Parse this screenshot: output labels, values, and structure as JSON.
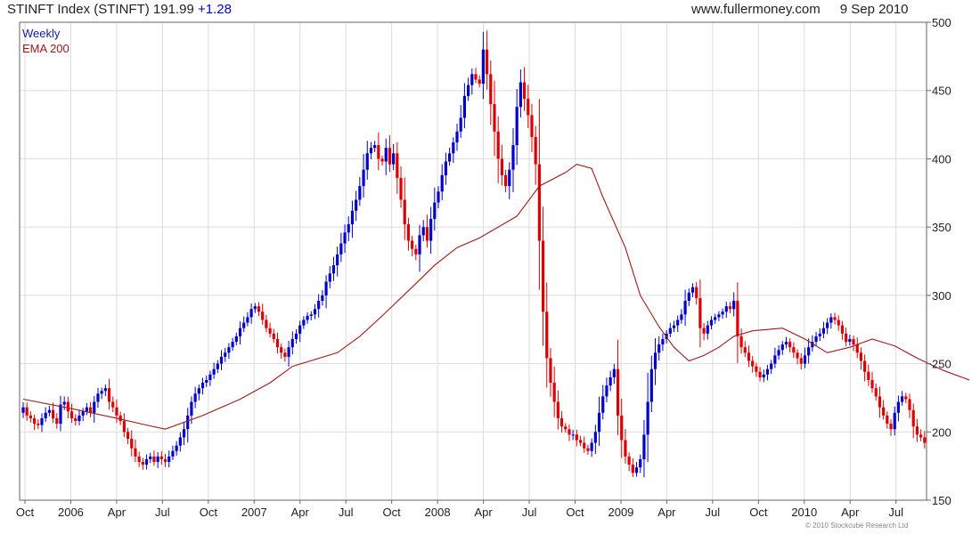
{
  "header": {
    "title": "STINFT Index (STINFT)",
    "last": "191.99",
    "change": "+1.28",
    "source": "www.fullermoney.com",
    "date": "9 Sep 2010"
  },
  "credit": "© 2010 Stockcube Research Ltd",
  "colors": {
    "up": "#0000cc",
    "down": "#dd0000",
    "ema": "#a01818",
    "grid": "#dcdcdc",
    "legend_weekly": "#1a1aa0",
    "legend_ema": "#a01818"
  },
  "chart_data": {
    "type": "candlestick",
    "frequency": "weekly",
    "x": {
      "ticks": [
        "Oct",
        "2006",
        "Apr",
        "Jul",
        "Oct",
        "2007",
        "Apr",
        "Jul",
        "Oct",
        "2008",
        "Apr",
        "Jul",
        "Oct",
        "2009",
        "Apr",
        "Jul",
        "Oct",
        "2010",
        "Apr",
        "Jul"
      ]
    },
    "y": {
      "ticks": [
        150,
        200,
        250,
        300,
        350,
        400,
        450,
        500
      ],
      "ylim": [
        150,
        500
      ],
      "position": "right"
    },
    "grid": true,
    "legend": {
      "position": "top-left",
      "items": [
        "Weekly",
        "EMA 200"
      ]
    },
    "series": [
      {
        "name": "Weekly",
        "closes": [
          218,
          212,
          210,
          206,
          205,
          210,
          214,
          216,
          210,
          206,
          220,
          222,
          215,
          210,
          208,
          212,
          215,
          218,
          214,
          222,
          228,
          230,
          232,
          222,
          218,
          212,
          208,
          200,
          195,
          188,
          182,
          178,
          176,
          180,
          182,
          178,
          182,
          180,
          178,
          182,
          186,
          190,
          196,
          202,
          212,
          222,
          228,
          232,
          236,
          238,
          242,
          246,
          250,
          255,
          258,
          262,
          266,
          270,
          276,
          280,
          284,
          290,
          292,
          288,
          282,
          276,
          272,
          268,
          262,
          258,
          255,
          262,
          268,
          272,
          278,
          282,
          285,
          286,
          290,
          296,
          300,
          310,
          316,
          322,
          330,
          338,
          346,
          352,
          362,
          370,
          380,
          392,
          404,
          408,
          410,
          400,
          398,
          408,
          396,
          404,
          386,
          370,
          352,
          340,
          334,
          330,
          344,
          350,
          340,
          356,
          368,
          376,
          388,
          398,
          404,
          412,
          420,
          430,
          446,
          454,
          462,
          458,
          455,
          480,
          462,
          440,
          420,
          400,
          388,
          380,
          392,
          410,
          438,
          456,
          444,
          432,
          416,
          396,
          340,
          288,
          254,
          236,
          222,
          210,
          204,
          202,
          198,
          198,
          194,
          192,
          188,
          186,
          192,
          200,
          214,
          226,
          234,
          240,
          246,
          212,
          194,
          182,
          176,
          170,
          174,
          180,
          198,
          222,
          246,
          258,
          264,
          268,
          272,
          276,
          278,
          282,
          286,
          296,
          302,
          306,
          298,
          276,
          272,
          278,
          282,
          284,
          286,
          288,
          292,
          290,
          296,
          270,
          262,
          258,
          252,
          248,
          244,
          240,
          242,
          246,
          250,
          256,
          260,
          264,
          266,
          262,
          258,
          254,
          250,
          256,
          262,
          266,
          270,
          272,
          276,
          280,
          284,
          282,
          278,
          272,
          266,
          268,
          264,
          258,
          252,
          244,
          238,
          232,
          226,
          218,
          212,
          206,
          202,
          214,
          222,
          226,
          224,
          216,
          204,
          198,
          196,
          192
        ]
      },
      {
        "name": "EMA 200",
        "points": [
          [
            0,
            224
          ],
          [
            13,
            217
          ],
          [
            25,
            210
          ],
          [
            33,
            205
          ],
          [
            38,
            202
          ],
          [
            48,
            212
          ],
          [
            58,
            224
          ],
          [
            66,
            236
          ],
          [
            72,
            248
          ],
          [
            84,
            258
          ],
          [
            90,
            270
          ],
          [
            96,
            285
          ],
          [
            104,
            306
          ],
          [
            110,
            322
          ],
          [
            116,
            335
          ],
          [
            122,
            342
          ],
          [
            132,
            358
          ],
          [
            138,
            380
          ],
          [
            145,
            390
          ],
          [
            148,
            396
          ],
          [
            152,
            393
          ],
          [
            155,
            372
          ],
          [
            161,
            335
          ],
          [
            165,
            300
          ],
          [
            170,
            277
          ],
          [
            174,
            262
          ],
          [
            178,
            252
          ],
          [
            182,
            256
          ],
          [
            186,
            262
          ],
          [
            190,
            270
          ],
          [
            195,
            274
          ],
          [
            203,
            276
          ],
          [
            209,
            268
          ],
          [
            215,
            258
          ],
          [
            221,
            262
          ],
          [
            227,
            268
          ],
          [
            233,
            263
          ],
          [
            239,
            254
          ],
          [
            246,
            245
          ],
          [
            253,
            238
          ]
        ]
      }
    ]
  }
}
